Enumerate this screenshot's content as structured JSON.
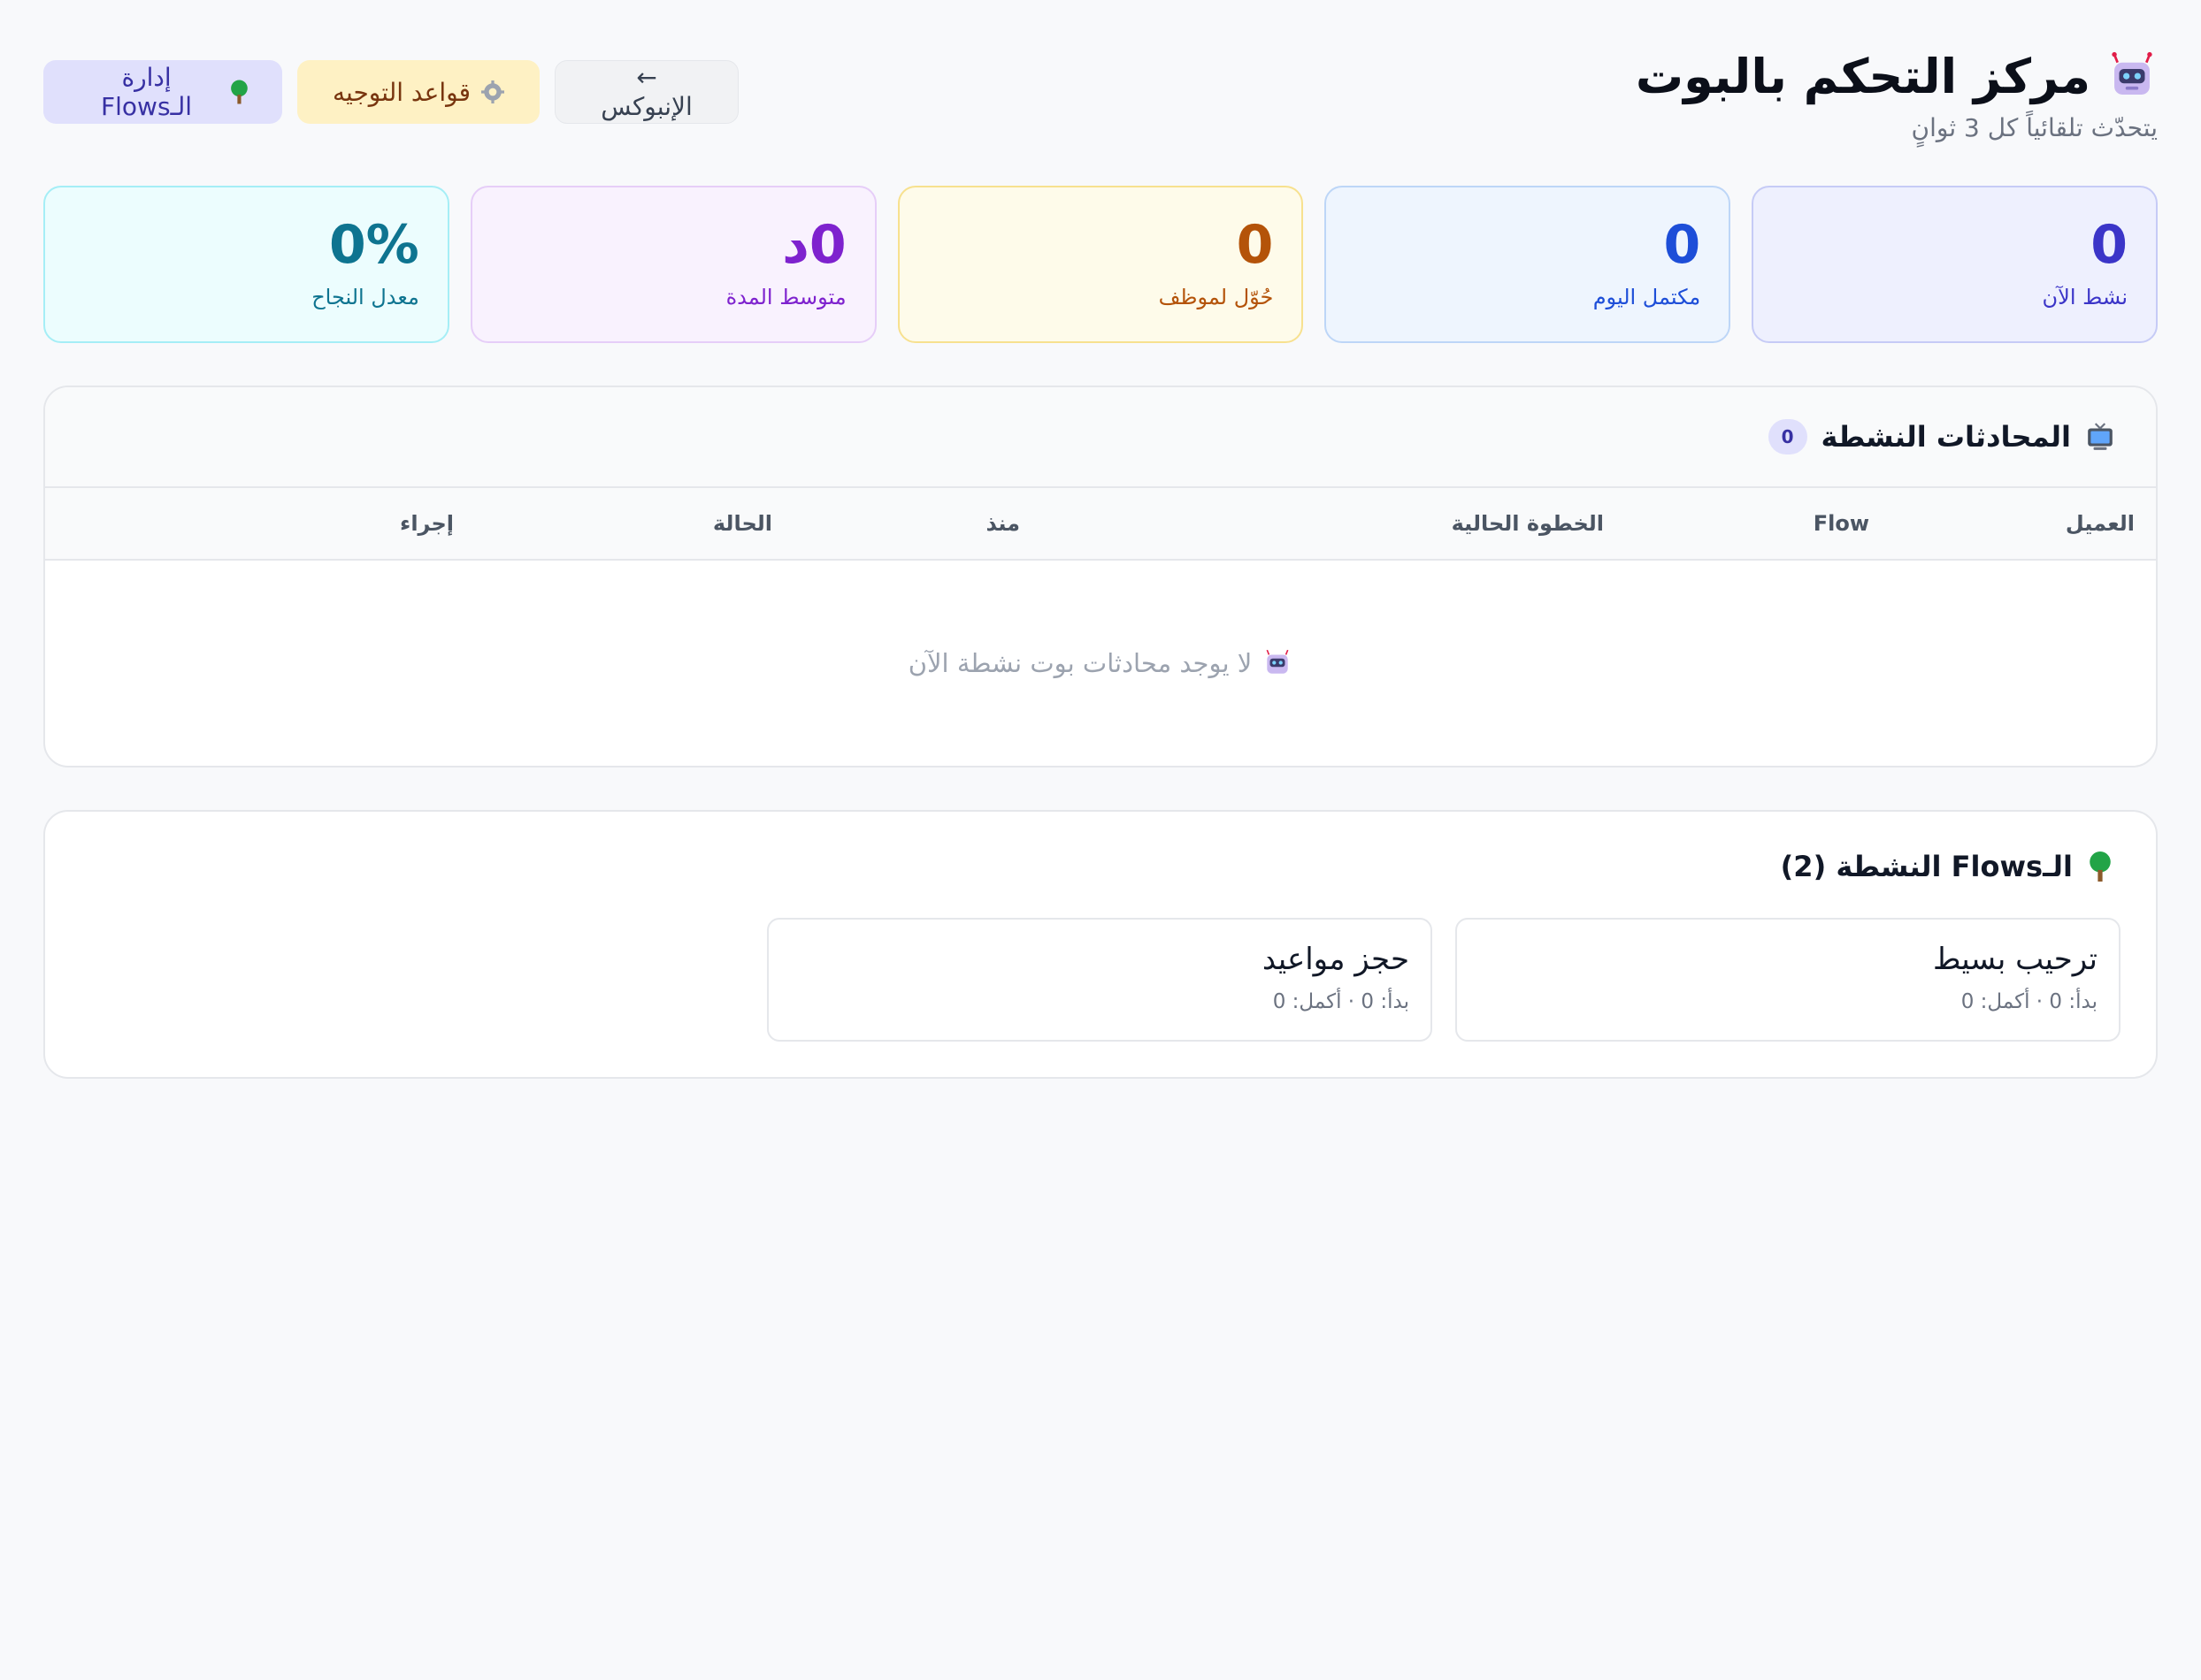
{
  "header": {
    "title": "مركز التحكم بالبوت",
    "subtitle": "يتحدّث تلقائياً كل 3 ثوانٍ"
  },
  "actions": {
    "inbox_label": "← الإنبوكس",
    "rules_label": "قواعد التوجيه",
    "flows_label": "إدارة الـFlows"
  },
  "stats": [
    {
      "value": "0",
      "label": "نشط الآن"
    },
    {
      "value": "0",
      "label": "مكتمل اليوم"
    },
    {
      "value": "0",
      "label": "حُوّل لموظف"
    },
    {
      "value": "0د",
      "label": "متوسط المدة"
    },
    {
      "value": "0%",
      "label": "معدل النجاح"
    }
  ],
  "conversations": {
    "title": "المحادثات النشطة",
    "count": "0",
    "columns": [
      "العميل",
      "Flow",
      "الخطوة الحالية",
      "منذ",
      "الحالة",
      "إجراء"
    ],
    "empty_text": "لا يوجد محادثات بوت نشطة الآن"
  },
  "flows": {
    "title": "الـFlows النشطة (2)",
    "items": [
      {
        "name": "ترحيب بسيط",
        "stats": "بدأ: 0 · أكمل: 0"
      },
      {
        "name": "حجز مواعيد",
        "stats": "بدأ: 0 · أكمل: 0"
      }
    ]
  },
  "icons": {
    "title_icon": "robot-icon",
    "rules_icon": "gear-icon",
    "flows_icon": "tree-icon",
    "conversations_icon": "tv-icon",
    "empty_icon": "robot-icon"
  },
  "colors": {
    "accent_indigo": "#3b35c8",
    "blue": "#1d4ed8",
    "amber": "#b45309",
    "purple": "#7e22ce",
    "cyan": "#0e7490"
  }
}
